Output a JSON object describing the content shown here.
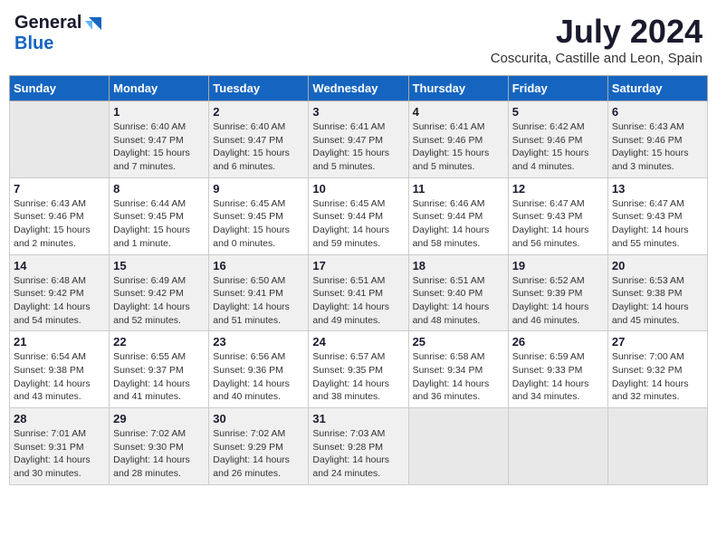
{
  "logo": {
    "general": "General",
    "blue": "Blue"
  },
  "title": "July 2024",
  "subtitle": "Coscurita, Castille and Leon, Spain",
  "days_of_week": [
    "Sunday",
    "Monday",
    "Tuesday",
    "Wednesday",
    "Thursday",
    "Friday",
    "Saturday"
  ],
  "weeks": [
    [
      {
        "day": "",
        "info": ""
      },
      {
        "day": "1",
        "info": "Sunrise: 6:40 AM\nSunset: 9:47 PM\nDaylight: 15 hours\nand 7 minutes."
      },
      {
        "day": "2",
        "info": "Sunrise: 6:40 AM\nSunset: 9:47 PM\nDaylight: 15 hours\nand 6 minutes."
      },
      {
        "day": "3",
        "info": "Sunrise: 6:41 AM\nSunset: 9:47 PM\nDaylight: 15 hours\nand 5 minutes."
      },
      {
        "day": "4",
        "info": "Sunrise: 6:41 AM\nSunset: 9:46 PM\nDaylight: 15 hours\nand 5 minutes."
      },
      {
        "day": "5",
        "info": "Sunrise: 6:42 AM\nSunset: 9:46 PM\nDaylight: 15 hours\nand 4 minutes."
      },
      {
        "day": "6",
        "info": "Sunrise: 6:43 AM\nSunset: 9:46 PM\nDaylight: 15 hours\nand 3 minutes."
      }
    ],
    [
      {
        "day": "7",
        "info": "Sunrise: 6:43 AM\nSunset: 9:46 PM\nDaylight: 15 hours\nand 2 minutes."
      },
      {
        "day": "8",
        "info": "Sunrise: 6:44 AM\nSunset: 9:45 PM\nDaylight: 15 hours\nand 1 minute."
      },
      {
        "day": "9",
        "info": "Sunrise: 6:45 AM\nSunset: 9:45 PM\nDaylight: 15 hours\nand 0 minutes."
      },
      {
        "day": "10",
        "info": "Sunrise: 6:45 AM\nSunset: 9:44 PM\nDaylight: 14 hours\nand 59 minutes."
      },
      {
        "day": "11",
        "info": "Sunrise: 6:46 AM\nSunset: 9:44 PM\nDaylight: 14 hours\nand 58 minutes."
      },
      {
        "day": "12",
        "info": "Sunrise: 6:47 AM\nSunset: 9:43 PM\nDaylight: 14 hours\nand 56 minutes."
      },
      {
        "day": "13",
        "info": "Sunrise: 6:47 AM\nSunset: 9:43 PM\nDaylight: 14 hours\nand 55 minutes."
      }
    ],
    [
      {
        "day": "14",
        "info": "Sunrise: 6:48 AM\nSunset: 9:42 PM\nDaylight: 14 hours\nand 54 minutes."
      },
      {
        "day": "15",
        "info": "Sunrise: 6:49 AM\nSunset: 9:42 PM\nDaylight: 14 hours\nand 52 minutes."
      },
      {
        "day": "16",
        "info": "Sunrise: 6:50 AM\nSunset: 9:41 PM\nDaylight: 14 hours\nand 51 minutes."
      },
      {
        "day": "17",
        "info": "Sunrise: 6:51 AM\nSunset: 9:41 PM\nDaylight: 14 hours\nand 49 minutes."
      },
      {
        "day": "18",
        "info": "Sunrise: 6:51 AM\nSunset: 9:40 PM\nDaylight: 14 hours\nand 48 minutes."
      },
      {
        "day": "19",
        "info": "Sunrise: 6:52 AM\nSunset: 9:39 PM\nDaylight: 14 hours\nand 46 minutes."
      },
      {
        "day": "20",
        "info": "Sunrise: 6:53 AM\nSunset: 9:38 PM\nDaylight: 14 hours\nand 45 minutes."
      }
    ],
    [
      {
        "day": "21",
        "info": "Sunrise: 6:54 AM\nSunset: 9:38 PM\nDaylight: 14 hours\nand 43 minutes."
      },
      {
        "day": "22",
        "info": "Sunrise: 6:55 AM\nSunset: 9:37 PM\nDaylight: 14 hours\nand 41 minutes."
      },
      {
        "day": "23",
        "info": "Sunrise: 6:56 AM\nSunset: 9:36 PM\nDaylight: 14 hours\nand 40 minutes."
      },
      {
        "day": "24",
        "info": "Sunrise: 6:57 AM\nSunset: 9:35 PM\nDaylight: 14 hours\nand 38 minutes."
      },
      {
        "day": "25",
        "info": "Sunrise: 6:58 AM\nSunset: 9:34 PM\nDaylight: 14 hours\nand 36 minutes."
      },
      {
        "day": "26",
        "info": "Sunrise: 6:59 AM\nSunset: 9:33 PM\nDaylight: 14 hours\nand 34 minutes."
      },
      {
        "day": "27",
        "info": "Sunrise: 7:00 AM\nSunset: 9:32 PM\nDaylight: 14 hours\nand 32 minutes."
      }
    ],
    [
      {
        "day": "28",
        "info": "Sunrise: 7:01 AM\nSunset: 9:31 PM\nDaylight: 14 hours\nand 30 minutes."
      },
      {
        "day": "29",
        "info": "Sunrise: 7:02 AM\nSunset: 9:30 PM\nDaylight: 14 hours\nand 28 minutes."
      },
      {
        "day": "30",
        "info": "Sunrise: 7:02 AM\nSunset: 9:29 PM\nDaylight: 14 hours\nand 26 minutes."
      },
      {
        "day": "31",
        "info": "Sunrise: 7:03 AM\nSunset: 9:28 PM\nDaylight: 14 hours\nand 24 minutes."
      },
      {
        "day": "",
        "info": ""
      },
      {
        "day": "",
        "info": ""
      },
      {
        "day": "",
        "info": ""
      }
    ]
  ]
}
